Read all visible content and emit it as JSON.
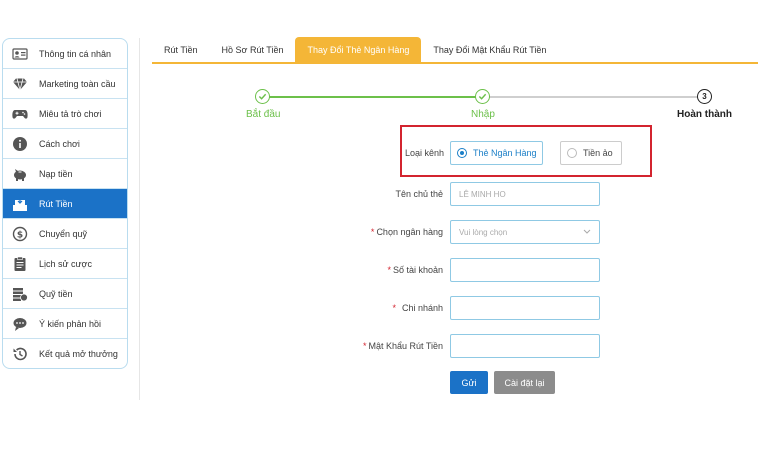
{
  "sidebar": {
    "items": [
      {
        "label": "Thông tin cá nhân",
        "icon": "user-card-icon"
      },
      {
        "label": "Marketing toàn cầu",
        "icon": "diamond-icon"
      },
      {
        "label": "Miêu tả trò chơi",
        "icon": "gamepad-icon"
      },
      {
        "label": "Cách chơi",
        "icon": "info-icon"
      },
      {
        "label": "Nạp tiền",
        "icon": "piggy-bank-icon"
      },
      {
        "label": "Rút Tiền",
        "icon": "withdraw-icon"
      },
      {
        "label": "Chuyển quỹ",
        "icon": "dollar-coin-icon"
      },
      {
        "label": "Lịch sử cược",
        "icon": "clipboard-icon"
      },
      {
        "label": "Quỹ tiền",
        "icon": "money-stack-icon"
      },
      {
        "label": "Ý kiến phản hồi",
        "icon": "chat-bubble-icon"
      },
      {
        "label": "Kết quả mở thưởng",
        "icon": "history-icon"
      }
    ],
    "active_index": 5
  },
  "tabs": [
    {
      "label": "Rút Tiền"
    },
    {
      "label": "Hồ Sơ Rút Tiền"
    },
    {
      "label": "Thay Đổi Thẻ Ngân Hàng"
    },
    {
      "label": "Thay Đổi Mật Khẩu Rút Tiền"
    }
  ],
  "steps": [
    {
      "label": "Bắt đầu",
      "state": "done"
    },
    {
      "label": "Nhập",
      "state": "done"
    },
    {
      "label": "Hoàn thành",
      "state": "pending",
      "number": "3"
    }
  ],
  "form": {
    "channel_label": "Loại kênh",
    "channel_options": [
      {
        "label": "Thẻ Ngân Hàng",
        "checked": true
      },
      {
        "label": "Tiền ảo",
        "checked": false
      }
    ],
    "holder_label": "Tên chủ thẻ",
    "holder_value": "LÊ MINH HO",
    "bank_label": "Chọn ngân hàng",
    "bank_placeholder": "Vui lòng chọn",
    "account_label": "Số tài khoản",
    "branch_label": "Chi nhánh",
    "password_label": "Mật Khẩu Rút Tiền",
    "submit_label": "Gửi",
    "reset_label": "Cài đặt lại"
  },
  "colors": {
    "accent_blue": "#1b72c7",
    "tab_orange": "#f4b637",
    "step_green": "#6cc04a",
    "highlight_red": "#d3242f",
    "reset_gray": "#8c8c8c"
  }
}
